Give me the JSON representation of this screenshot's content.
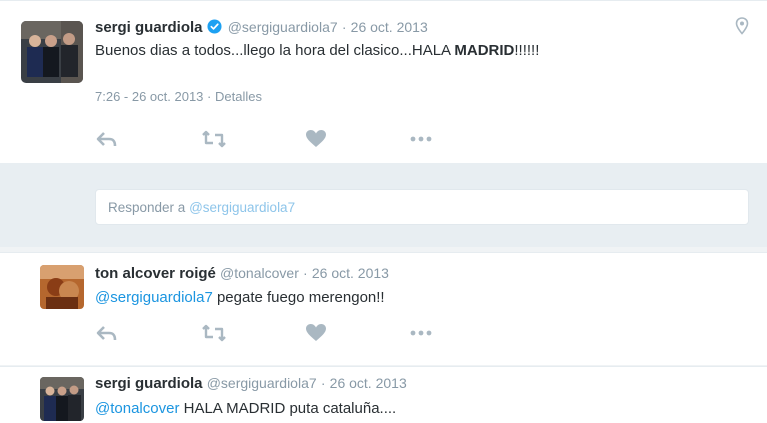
{
  "tweet1": {
    "name": "sergi guardiola",
    "handle": "@sergiguardiola7",
    "separator": "·",
    "date": "26 oct. 2013",
    "text_prefix": "Buenos dias a todos...llego la hora del clasico...HALA ",
    "text_bold": "MADRID",
    "text_suffix": "!!!!!!",
    "timestamp": "7:26 - 26 oct. 2013",
    "meta_separator": "·",
    "details_link": "Detalles"
  },
  "reply": {
    "prefix": "Responder a ",
    "mention": "@sergiguardiola7"
  },
  "tweet2": {
    "name": "ton alcover roigé",
    "handle": "@tonalcover",
    "separator": "·",
    "date": "26 oct. 2013",
    "mention": "@sergiguardiola7",
    "text": " pegate fuego merengon!!"
  },
  "tweet3": {
    "name": "sergi guardiola",
    "handle": "@sergiguardiola7",
    "separator": "·",
    "date": "26 oct. 2013",
    "mention": "@tonalcover",
    "text": " HALA MADRID puta cataluña...."
  },
  "icons": {
    "reply": "reply-arrow-icon",
    "retweet": "retweet-icon",
    "like": "heart-icon",
    "more": "more-dots-icon",
    "verified": "verified-badge-icon",
    "location": "location-pin-icon"
  },
  "colors": {
    "link": "#1b95e0",
    "muted": "#8899a6",
    "verified": "#1da1f2",
    "action_icon": "#aab8c2"
  }
}
